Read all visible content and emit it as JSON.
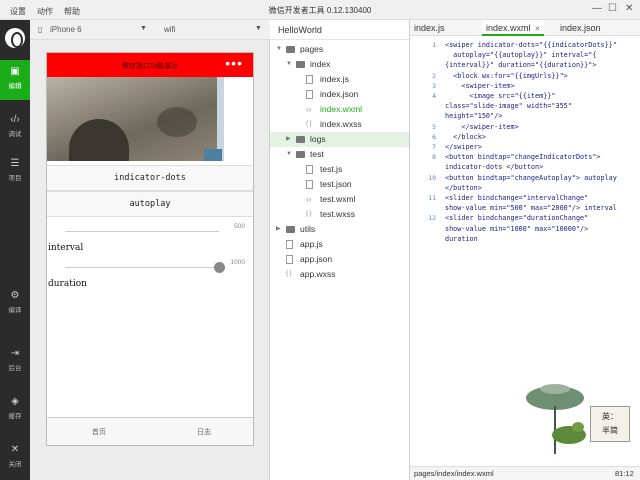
{
  "menubar": {
    "menus": [
      "设置",
      "动作",
      "帮助"
    ],
    "title": "微信开发者工具 0.12.130400",
    "controls": [
      "minimize-icon",
      "maximize-icon",
      "close-icon"
    ]
  },
  "toolbar": {
    "items": [
      {
        "label": "编辑",
        "icon": "edit-icon"
      },
      {
        "label": "调试",
        "icon": "code-icon"
      },
      {
        "label": "项目",
        "icon": "menu-icon"
      },
      {
        "label": "编译",
        "icon": "compile-icon"
      },
      {
        "label": "后台",
        "icon": "background-icon"
      },
      {
        "label": "缓存",
        "icon": "cache-icon"
      },
      {
        "label": "关闭",
        "icon": "close-icon"
      }
    ]
  },
  "simulator": {
    "device": "iPhone 6",
    "network": "wifi",
    "page": {
      "nav_title": "微信接口功能演示",
      "nav_menu": "•••",
      "indicator_button": "indicator-dots",
      "autoplay_button": "autoplay",
      "interval": {
        "label": "interval",
        "value": "500",
        "fraction": 0.0
      },
      "duration": {
        "label": "duration",
        "value": "1000",
        "fraction": 1.0
      },
      "tabs": [
        "首页",
        "日志"
      ]
    }
  },
  "explorer": {
    "project": "HelloWorld",
    "tree": [
      {
        "name": "pages",
        "type": "folder",
        "depth": 0,
        "open": true
      },
      {
        "name": "index",
        "type": "folder",
        "depth": 1,
        "open": true
      },
      {
        "name": "index.js",
        "type": "js",
        "depth": 2
      },
      {
        "name": "index.json",
        "type": "json",
        "depth": 2
      },
      {
        "name": "index.wxml",
        "type": "wxml",
        "depth": 2,
        "highlight": true
      },
      {
        "name": "index.wxss",
        "type": "wxss",
        "depth": 2
      },
      {
        "name": "logs",
        "type": "folder",
        "depth": 1,
        "open": false,
        "selected": true
      },
      {
        "name": "test",
        "type": "folder",
        "depth": 1,
        "open": true
      },
      {
        "name": "test.js",
        "type": "js",
        "depth": 2
      },
      {
        "name": "test.json",
        "type": "json",
        "depth": 2
      },
      {
        "name": "test.wxml",
        "type": "wxml",
        "depth": 2
      },
      {
        "name": "test.wxss",
        "type": "wxss",
        "depth": 2
      },
      {
        "name": "utils",
        "type": "folder",
        "depth": 0,
        "open": false
      },
      {
        "name": "app.js",
        "type": "js",
        "depth": 0
      },
      {
        "name": "app.json",
        "type": "json",
        "depth": 0
      },
      {
        "name": "app.wxss",
        "type": "wxss",
        "depth": 0
      }
    ]
  },
  "editor": {
    "tabs": [
      {
        "label": "index.js",
        "active": false
      },
      {
        "label": "index.wxml",
        "active": true
      },
      {
        "label": "index.json",
        "active": false
      }
    ],
    "lines": [
      {
        "n": "1",
        "t": "<swiper indicator-dots=\"{{indicatorDots}}\""
      },
      {
        "n": "",
        "t": "  autoplay=\"{{autoplay}}\" interval=\"{"
      },
      {
        "n": "",
        "t": "{interval}}\" duration=\"{{duration}}\">"
      },
      {
        "n": "2",
        "t": "  <block wx:for=\"{{imgUrls}}\">"
      },
      {
        "n": "3",
        "t": "    <swiper-item>"
      },
      {
        "n": "4",
        "t": "      <image src=\"{{item}}\""
      },
      {
        "n": "",
        "t": "class=\"slide-image\" width=\"355\""
      },
      {
        "n": "",
        "t": "height=\"150\"/>"
      },
      {
        "n": "5",
        "t": "    </swiper-item>"
      },
      {
        "n": "6",
        "t": "  </block>"
      },
      {
        "n": "7",
        "t": "</swiper>"
      },
      {
        "n": "8",
        "t": "<button bindtap=\"changeIndicatorDots\">"
      },
      {
        "n": "",
        "t": "indicator-dots </button>"
      },
      {
        "n": "10",
        "t": "<button bindtap=\"changeAutoplay\"> autoplay"
      },
      {
        "n": "",
        "t": "</button>"
      },
      {
        "n": "11",
        "t": "<slider bindchange=\"intervalChange\""
      },
      {
        "n": "",
        "t": "show-value min=\"500\" max=\"2000\"/> interval"
      },
      {
        "n": "12",
        "t": "<slider bindchange=\"durationChange\""
      },
      {
        "n": "",
        "t": "show-value min=\"1000\" max=\"10000\"/>"
      },
      {
        "n": "",
        "t": "duration"
      }
    ],
    "status_path": "pages/index/index.wxml",
    "status_pos": "81:12"
  },
  "art": {
    "seal_line1": "英：",
    "seal_line2": "半简"
  },
  "colors": {
    "brand_green": "#1aad19",
    "nav_red": "#ff0000",
    "toolbar_dark": "#2b2b2b"
  }
}
